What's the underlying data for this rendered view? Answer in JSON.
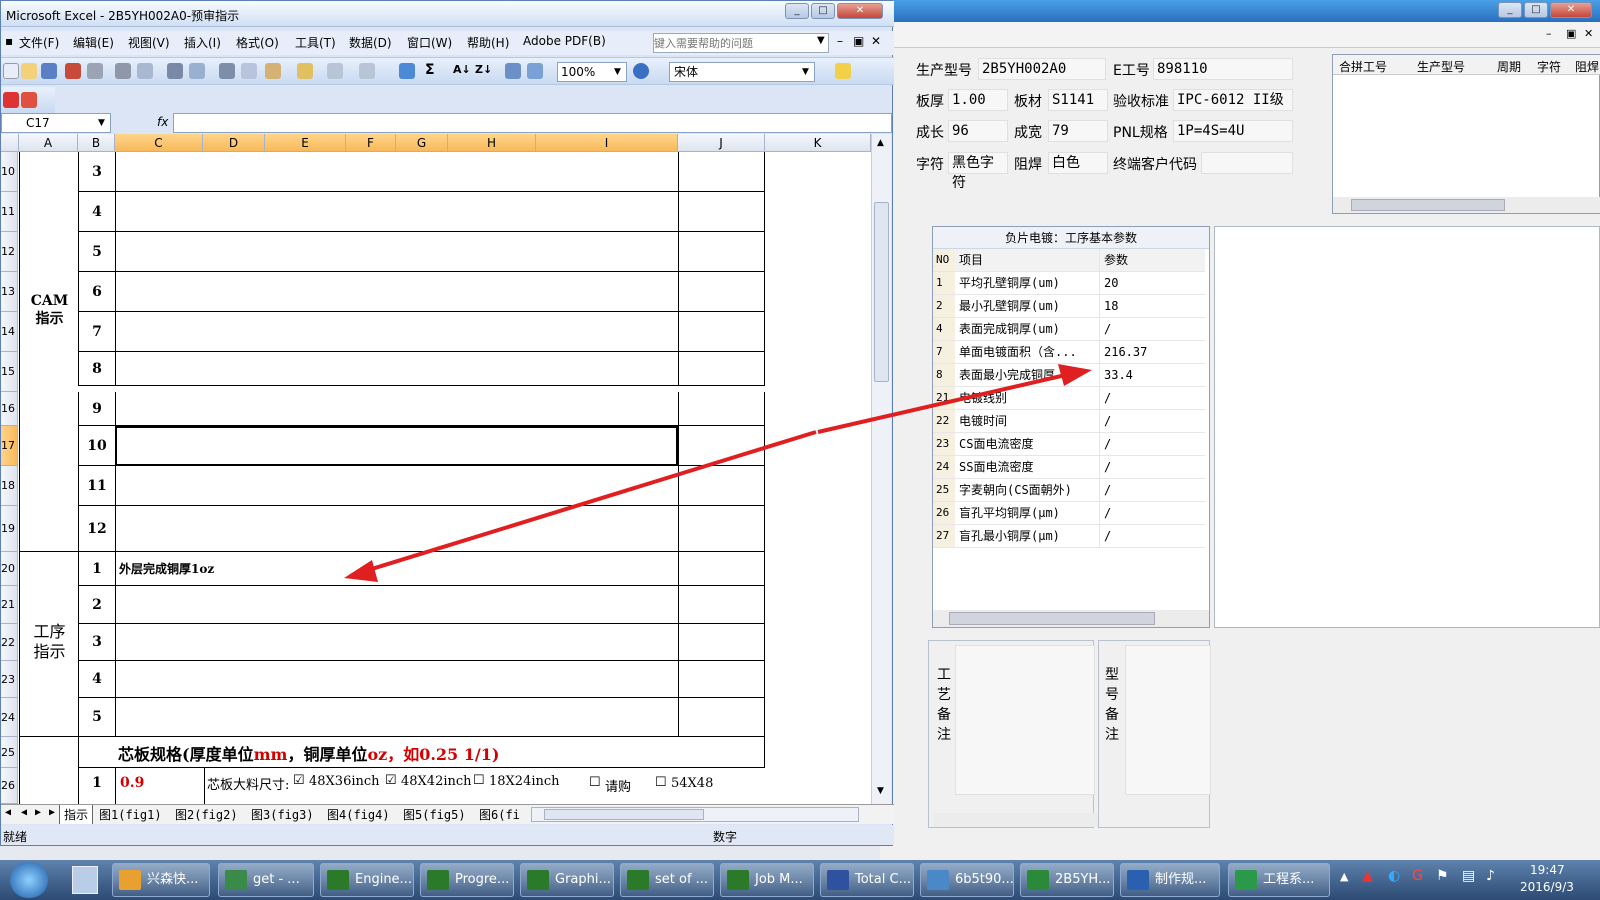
{
  "excel": {
    "title": "Microsoft Excel - 2B5YH002A0-预审指示",
    "menu": [
      "文件(F)",
      "编辑(E)",
      "视图(V)",
      "插入(I)",
      "格式(O)",
      "工具(T)",
      "数据(D)",
      "窗口(W)",
      "帮助(H)",
      "Adobe PDF(B)"
    ],
    "help_placeholder": "键入需要帮助的问题",
    "zoom": "100%",
    "font": "宋体",
    "namebox": "C17",
    "fx": "fx",
    "columns": [
      "A",
      "B",
      "C",
      "D",
      "E",
      "F",
      "G",
      "H",
      "I",
      "J",
      "K"
    ],
    "row_numbers": [
      "10",
      "11",
      "12",
      "13",
      "14",
      "15",
      "16",
      "17",
      "18",
      "19",
      "20",
      "21",
      "22",
      "23",
      "24",
      "25",
      "26"
    ],
    "cam_label": "CAM\n指示",
    "cam_numbers": [
      "3",
      "4",
      "5",
      "6",
      "7",
      "8",
      "9",
      "10",
      "11",
      "12"
    ],
    "process_label": "工序\n指示",
    "process_numbers": [
      "1",
      "2",
      "3",
      "4",
      "5"
    ],
    "process_first_text": "外层完成铜厚1oz",
    "core_spec_heading": "芯板规格(厚度单位",
    "core_spec_mm": "mm",
    "core_spec_mid": "，铜厚单位",
    "core_spec_oz": "oz",
    "core_spec_example": "，如0.25 1/1)",
    "core_row_number": "1",
    "core_value": "0.9",
    "core_size_label": "芯板大料尺寸:",
    "opt1": "48X36inch",
    "opt2": "48X42inch",
    "opt3": "18X24inch",
    "opt4": "请购",
    "opt5": "54X48",
    "sheet_tabs": [
      "指示",
      "图1(fig1)",
      "图2(fig2)",
      "图3(fig3)",
      "图4(fig4)",
      "图5(fig5)",
      "图6(fi"
    ],
    "status_left": "就绪",
    "status_mid": "数字"
  },
  "app": {
    "header": {
      "model_label": "生产型号",
      "model_value": "2B5YH002A0",
      "eng_label": "E工号",
      "eng_value": "898110",
      "thickness_label": "板厚",
      "thickness_value": "1.00",
      "material_label": "板材",
      "material_value": "S1141",
      "standard_label": "验收标准",
      "standard_value": "IPC-6012 II级",
      "length_label": "成长",
      "length_value": "96",
      "width_label": "成宽",
      "width_value": "79",
      "pnl_label": "PNL规格",
      "pnl_value": "1P=4S=4U",
      "char_label": "字符",
      "char_value": "黑色字符",
      "mask_label": "阻焊",
      "mask_value": "白色",
      "customer_label": "终端客户代码",
      "customer_value": ""
    },
    "grid_headers": [
      "合拼工号",
      "生产型号",
      "周期",
      "字符",
      "阻焊"
    ],
    "params_title": "负片电镀：工序基本参数",
    "params_headers": {
      "no": "NO",
      "item": "项目",
      "value": "参数"
    },
    "params": [
      {
        "no": "1",
        "item": "平均孔壁铜厚(um)",
        "value": "20"
      },
      {
        "no": "2",
        "item": "最小孔壁铜厚(um)",
        "value": "18"
      },
      {
        "no": "4",
        "item": "表面完成铜厚(um)",
        "value": "/"
      },
      {
        "no": "7",
        "item": "单面电镀面积（含...",
        "value": "216.37"
      },
      {
        "no": "8",
        "item": "表面最小完成铜厚",
        "value": "33.4"
      },
      {
        "no": "21",
        "item": "电镀线别",
        "value": "/"
      },
      {
        "no": "22",
        "item": "电镀时间",
        "value": "/"
      },
      {
        "no": "23",
        "item": "CS面电流密度",
        "value": "/"
      },
      {
        "no": "24",
        "item": "SS面电流密度",
        "value": "/"
      },
      {
        "no": "25",
        "item": "字麦朝向(CS面朝外)",
        "value": "/"
      },
      {
        "no": "26",
        "item": "盲孔平均铜厚(μm)",
        "value": "/"
      },
      {
        "no": "27",
        "item": "盲孔最小铜厚(μm)",
        "value": "/"
      }
    ],
    "process_note_label": "工\n艺\n备\n注",
    "model_note_label": "型\n号\n备\n注"
  },
  "taskbar": {
    "items": [
      "兴森快...",
      "get - ...",
      "Engine...",
      "Progre...",
      "Graphi...",
      "set of ...",
      "Job M...",
      "Total C...",
      "6b5t90...",
      "2B5YH...",
      "制作规...",
      "工程系..."
    ],
    "time": "19:47",
    "date": "2016/9/3"
  },
  "colors": {
    "arrow": "#e02020",
    "accent_red": "#d40000",
    "selection_header": "#f7b95a"
  }
}
